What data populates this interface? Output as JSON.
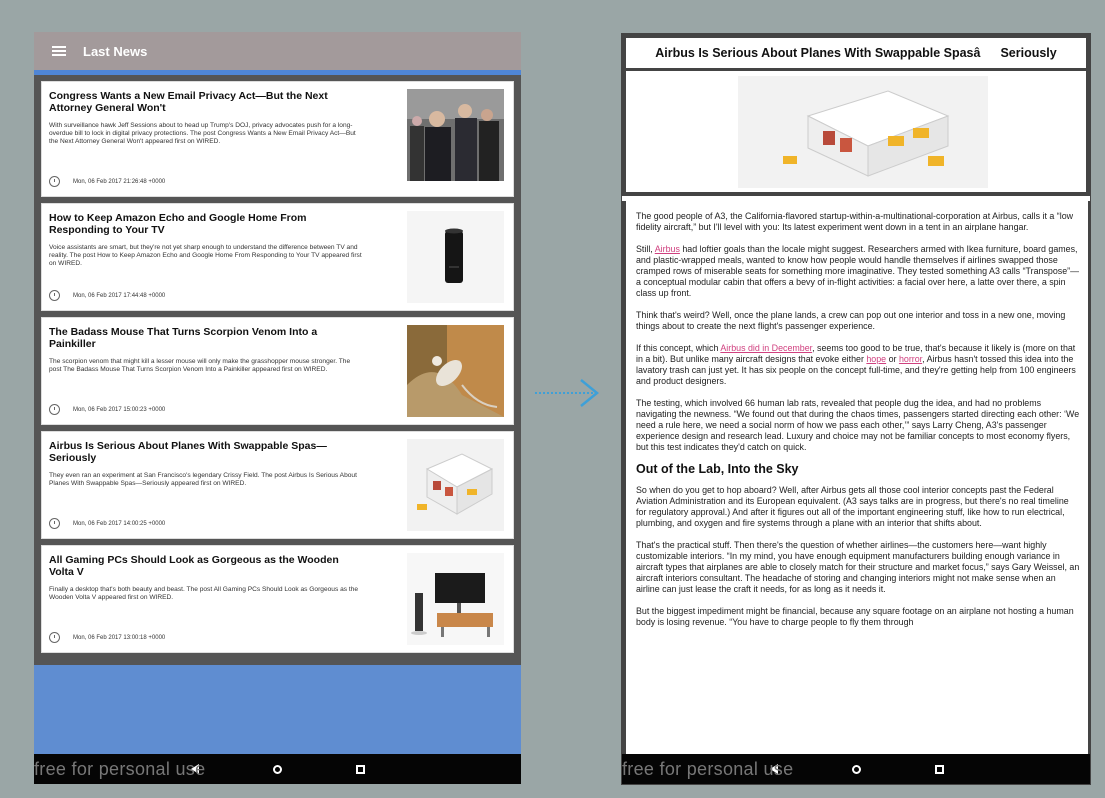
{
  "left_app": {
    "title": "Last News",
    "articles": [
      {
        "title": "Congress Wants a New Email Privacy Act—But the Next Attorney General Won't",
        "description": "With surveillance hawk Jeff Sessions about to head up Trump's DOJ, privacy advocates push for a long-overdue bill to lock in digital privacy protections. The post Congress Wants a New Email Privacy Act—But the Next Attorney General Won't appeared first on WIRED.",
        "date": "Mon, 06 Feb 2017 21:26:48 +0000",
        "thumb": "people-photo"
      },
      {
        "title": "How to Keep Amazon Echo and Google Home From Responding to Your TV",
        "description": "Voice assistants are smart, but they're not yet sharp enough to understand the difference between TV and reality. The post How to Keep Amazon Echo and Google Home From Responding to Your TV appeared first on WIRED.",
        "date": "Mon, 06 Feb 2017 17:44:48 +0000",
        "thumb": "echo-speaker"
      },
      {
        "title": "The Badass Mouse That Turns Scorpion Venom Into a Painkiller",
        "description": "The scorpion venom that might kill a lesser mouse will only make the grasshopper mouse stronger. The post The Badass Mouse That Turns Scorpion Venom Into a Painkiller appeared first on WIRED.",
        "date": "Mon, 06 Feb 2017 15:00:23 +0000",
        "thumb": "mouse-photo"
      },
      {
        "title": "Airbus Is Serious About Planes With Swappable Spas—Seriously",
        "description": "They even ran an experiment at San Francisco's legendary Crissy Field. The post Airbus Is Serious About Planes With Swappable Spas—Seriously appeared first on WIRED.",
        "date": "Mon, 06 Feb 2017 14:00:25 +0000",
        "thumb": "cabin-module"
      },
      {
        "title": "All Gaming PCs Should Look as Gorgeous as the Wooden Volta V",
        "description": "Finally a desktop that's both beauty and beast. The post All Gaming PCs Should Look as Gorgeous as the Wooden Volta V appeared first on WIRED.",
        "date": "Mon, 06 Feb 2017 13:00:18 +0000",
        "thumb": "desk-pc"
      }
    ],
    "watermark": "free for personal use"
  },
  "right_app": {
    "title": "Airbus Is Serious About Planes With Swappable SpasâSeriously",
    "paragraphs": [
      {
        "type": "p",
        "parts": [
          {
            "t": "The good people of A3, the California-flavored startup-within-a-multinational-corporation at Airbus, calls it a “low fidelity aircraft,” but I'll level with you: Its latest experiment went down in a tent in an airplane hangar."
          }
        ]
      },
      {
        "type": "p",
        "parts": [
          {
            "t": "Still, "
          },
          {
            "t": "Airbus",
            "link": true
          },
          {
            "t": " had loftier goals than the locale might suggest. Researchers armed with Ikea furniture, board games, and plastic-wrapped meals, wanted to know how people would handle themselves if airlines swapped those cramped rows of miserable seats for something more imaginative. They tested something A3 calls “Transpose”—a conceptual modular cabin that offers a bevy of in-flight activities: a facial over here, a latte over there, a spin class up front."
          }
        ]
      },
      {
        "type": "p",
        "parts": [
          {
            "t": "Think that's weird? Well, once the plane lands, a crew can pop out one interior and toss in a new one, moving things about to create the next flight's passenger experience."
          }
        ]
      },
      {
        "type": "p",
        "parts": [
          {
            "t": "If this concept, which "
          },
          {
            "t": "Airbus did in December",
            "link": true
          },
          {
            "t": ", seems too good to be true, that's because it likely is (more on that in a bit). But unlike many aircraft designs that evoke either "
          },
          {
            "t": "hope",
            "link": true
          },
          {
            "t": " or "
          },
          {
            "t": "horror",
            "link": true
          },
          {
            "t": ", Airbus hasn't tossed this idea into the lavatory trash can just yet. It has six people on the concept full-time, and they're getting help from 100 engineers and product designers."
          }
        ]
      },
      {
        "type": "p",
        "parts": [
          {
            "t": "The testing, which involved 66 human lab rats, revealed that people dug the idea, and had no problems navigating the newness. “We found out that during the chaos times, passengers started directing each other: ‘We need a rule here, we need a social norm of how we pass each other,’” says Larry Cheng, A3's passenger experience design and research lead. Luxury and choice may not be familiar concepts to most economy flyers, but this test indicates they'd catch on quick."
          }
        ]
      },
      {
        "type": "h2",
        "parts": [
          {
            "t": "Out of the Lab, Into the Sky"
          }
        ]
      },
      {
        "type": "p",
        "parts": [
          {
            "t": "So when do you get to hop aboard? Well, after Airbus gets all those cool interior concepts past the Federal Aviation Administration and its European equivalent. (A3 says talks are in progress, but there's no real timeline for regulatory approval.) And after it figures out all of the important engineering stuff, like how to run electrical, plumbing, and oxygen and fire systems through a plane with an interior that shifts about."
          }
        ]
      },
      {
        "type": "p",
        "parts": [
          {
            "t": "That's the practical stuff. Then there's the question of whether airlines—the customers here—want highly customizable interiors. “In my mind, you have enough equipment manufacturers building enough variance in aircraft types that airplanes are able to closely match for their structure and market focus,” says Gary Weissel, an aircraft interiors consultant. The headache of storing and changing interiors might not make sense when an airline can just lease the craft it needs, for as long as it needs it."
          }
        ]
      },
      {
        "type": "p",
        "parts": [
          {
            "t": "But the biggest impediment might be financial, because any square footage on an airplane not hosting a human body is losing revenue. “You have to charge people to fly them through"
          }
        ]
      }
    ],
    "watermark": "free for personal use"
  },
  "colors": {
    "link": "#d0407f",
    "appbar": "#a39a9b",
    "feed_bg": "#5f8dd1"
  }
}
